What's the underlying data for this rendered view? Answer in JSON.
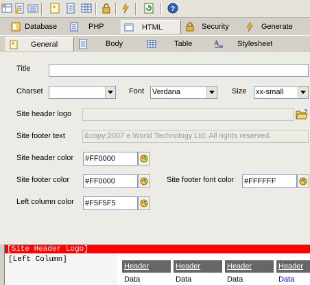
{
  "toolbar": {
    "icons": [
      "grid-icon",
      "properties-icon",
      "folder-list-icon",
      "page-icon",
      "document-icon",
      "table-icon",
      "lock-icon",
      "lightning-icon",
      "refresh-icon",
      "help-icon"
    ]
  },
  "tabs_main": [
    {
      "label": "Database",
      "icon": "database-icon"
    },
    {
      "label": "PHP",
      "icon": "php-icon"
    },
    {
      "label": "HTML",
      "icon": "html-icon",
      "active": true
    },
    {
      "label": "Security",
      "icon": "lock-icon"
    },
    {
      "label": "Generate",
      "icon": "lightning-icon"
    }
  ],
  "tabs_sub": [
    {
      "label": "General",
      "icon": "page-icon",
      "active": true
    },
    {
      "label": "Body",
      "icon": "document-icon"
    },
    {
      "label": "Table",
      "icon": "table-icon"
    },
    {
      "label": "Stylesheet",
      "icon": "text-style-icon"
    }
  ],
  "form": {
    "title_label": "Title",
    "title_value": "",
    "charset_label": "Charset",
    "charset_value": "",
    "font_label": "Font",
    "font_value": "Verdana",
    "size_label": "Size",
    "size_value": "xx-small",
    "header_logo_label": "Site header logo",
    "header_logo_value": "",
    "footer_text_label": "Site footer text",
    "footer_text_value": "&copy;2007 e.World Technology Ltd. All rights reserved.",
    "header_color_label": "Site header color",
    "header_color_value": "#FF0000",
    "footer_color_label": "Site footer color",
    "footer_color_value": "#FF0000",
    "footer_font_color_label": "Site footer font color",
    "footer_font_color_value": "#FFFFFF",
    "left_column_color_label": "Left column color",
    "left_column_color_value": "#F5F5F5"
  },
  "preview": {
    "header_text": "[Site Header Logo]",
    "left_column_text": "[Left Column]",
    "headers": [
      "Header",
      "Header",
      "Header",
      "Header"
    ],
    "cells": [
      "Data",
      "Data",
      "Data",
      "Data"
    ],
    "colors": {
      "header_bg": "#FF0000",
      "left_bg": "#F5F5F5",
      "th_bg": "#666666"
    }
  }
}
